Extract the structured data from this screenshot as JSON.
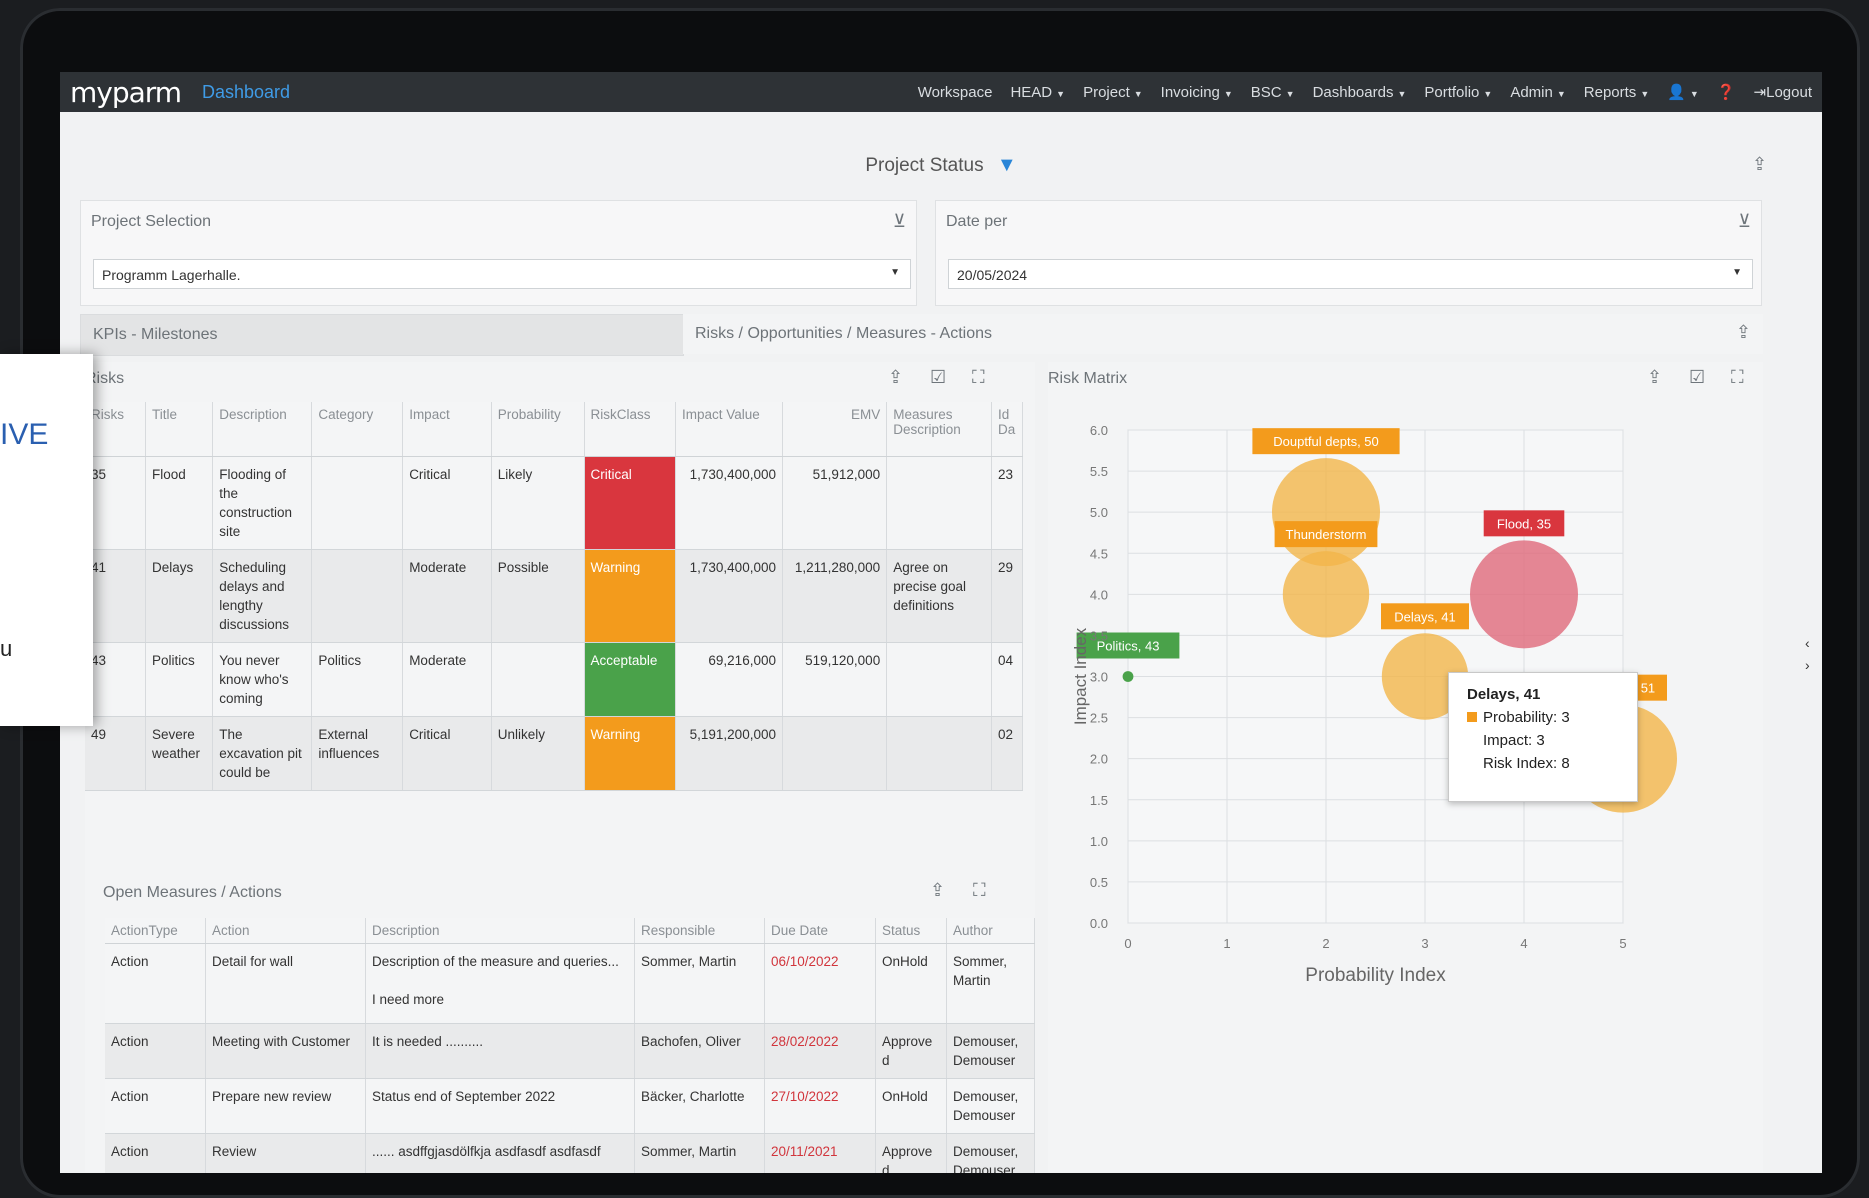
{
  "nav": {
    "logo": "myparm",
    "title": "Dashboard",
    "menu": [
      "Workspace",
      "HEAD",
      "Project",
      "Invoicing",
      "BSC",
      "Dashboards",
      "Portfolio",
      "Admin",
      "Reports"
    ],
    "logout": "Logout"
  },
  "page": {
    "title": "Project Status"
  },
  "filters": {
    "project_label": "Project Selection",
    "project_value": "Programm Lagerhalle.",
    "date_label": "Date per",
    "date_value": "20/05/2024"
  },
  "tabs": [
    "KPIs - Milestones",
    "Risks / Opportunities / Measures - Actions"
  ],
  "risks": {
    "title": "Risks",
    "headers": [
      "Risks",
      "Title",
      "Description",
      "Category",
      "Impact",
      "Probability",
      "RiskClass",
      "Impact Value",
      "EMV",
      "Measures Description",
      "Id Da"
    ],
    "rows": [
      {
        "id": "35",
        "title": "Flood",
        "desc": "Flooding of the construction site",
        "cat": "",
        "impact": "Critical",
        "prob": "Likely",
        "cls": "Critical",
        "clsColor": "red",
        "iv": "1,730,400,000",
        "emv": "51,912,000",
        "measures": "",
        "idd": "23"
      },
      {
        "id": "41",
        "title": "Delays",
        "desc": "Scheduling delays and lengthy discussions",
        "cat": "",
        "impact": "Moderate",
        "prob": "Possible",
        "cls": "Warning",
        "clsColor": "orange",
        "iv": "1,730,400,000",
        "emv": "1,211,280,000",
        "measures": "Agree on precise goal definitions",
        "idd": "29"
      },
      {
        "id": "43",
        "title": "Politics",
        "desc": "You never know who's coming",
        "cat": "Politics",
        "impact": "Moderate",
        "prob": "",
        "cls": "Acceptable",
        "clsColor": "green",
        "iv": "69,216,000",
        "emv": "519,120,000",
        "measures": "",
        "idd": "04"
      },
      {
        "id": "49",
        "title": "Severe weather",
        "desc": "The excavation pit could be",
        "cat": "External influences",
        "impact": "Critical",
        "prob": "Unlikely",
        "cls": "Warning",
        "clsColor": "orange",
        "iv": "5,191,200,000",
        "emv": "",
        "measures": "",
        "idd": "02"
      }
    ]
  },
  "measures": {
    "title": "Open Measures / Actions",
    "headers": [
      "ActionType",
      "Action",
      "Description",
      "Responsible",
      "Due Date",
      "Status",
      "Author"
    ],
    "rows": [
      {
        "type": "Action",
        "action": "Detail for wall",
        "desc": "Description of the measure and queries...\n\nI need more",
        "resp": "Sommer, Martin",
        "due": "06/10/2022",
        "status": "OnHold",
        "author": "Sommer, Martin"
      },
      {
        "type": "Action",
        "action": "Meeting with Customer",
        "desc": "It is needed ..........",
        "resp": "Bachofen, Oliver",
        "due": "28/02/2022",
        "status": "Approve d",
        "author": "Demouser, Demouser"
      },
      {
        "type": "Action",
        "action": "Prepare new review",
        "desc": "Status end of September 2022",
        "resp": "Bäcker, Charlotte",
        "due": "27/10/2022",
        "status": "OnHold",
        "author": "Demouser, Demouser"
      },
      {
        "type": "Action",
        "action": "Review",
        "desc": "...... asdffgjasdölfkja asdfasdf asdfasdf",
        "resp": "Sommer, Martin",
        "due": "20/11/2021",
        "status": "Approve d",
        "author": "Demouser, Demouser"
      }
    ]
  },
  "matrix": {
    "title": "Risk Matrix",
    "tooltip": {
      "title": "Delays, 41",
      "lines": [
        "Probability: 3",
        "Impact: 3",
        "Risk Index: 8"
      ]
    }
  },
  "sidecard": {
    "text1": "IVE",
    "text2": "u"
  },
  "colors": {
    "bubble": "#f3b54a",
    "bubble_red": "#e0697a",
    "green": "#4aa24a",
    "accent": "#3f9be6"
  },
  "chart_data": {
    "type": "scatter",
    "xlabel": "Probability Index",
    "ylabel": "Impact Index",
    "xlim": [
      0,
      5
    ],
    "ylim": [
      0,
      6
    ],
    "xticks": [
      "0",
      "1",
      "2",
      "3",
      "4",
      "5"
    ],
    "yticks": [
      "0.0",
      "0.5",
      "1.0",
      "1.5",
      "2.0",
      "2.5",
      "3.0",
      "3.5",
      "4.0",
      "4.5",
      "5.0",
      "5.5",
      "6.0"
    ],
    "grid": true,
    "points": [
      {
        "label": "Douptful depts, 50",
        "x": 2,
        "y": 5,
        "size": 1.0,
        "color": "orange"
      },
      {
        "label": "Thunderstorm",
        "x": 2,
        "y": 4,
        "size": 0.8,
        "color": "orange"
      },
      {
        "label": "Flood, 35",
        "x": 4,
        "y": 4,
        "size": 1.0,
        "color": "red"
      },
      {
        "label": "Delays, 41",
        "x": 3,
        "y": 3,
        "size": 0.8,
        "color": "orange"
      },
      {
        "label": "Politics, 43",
        "x": 0,
        "y": 3,
        "size": 0.1,
        "color": "green"
      },
      {
        "label": "Corona, 51",
        "x": 5,
        "y": 2,
        "size": 1.0,
        "color": "orange"
      }
    ]
  }
}
